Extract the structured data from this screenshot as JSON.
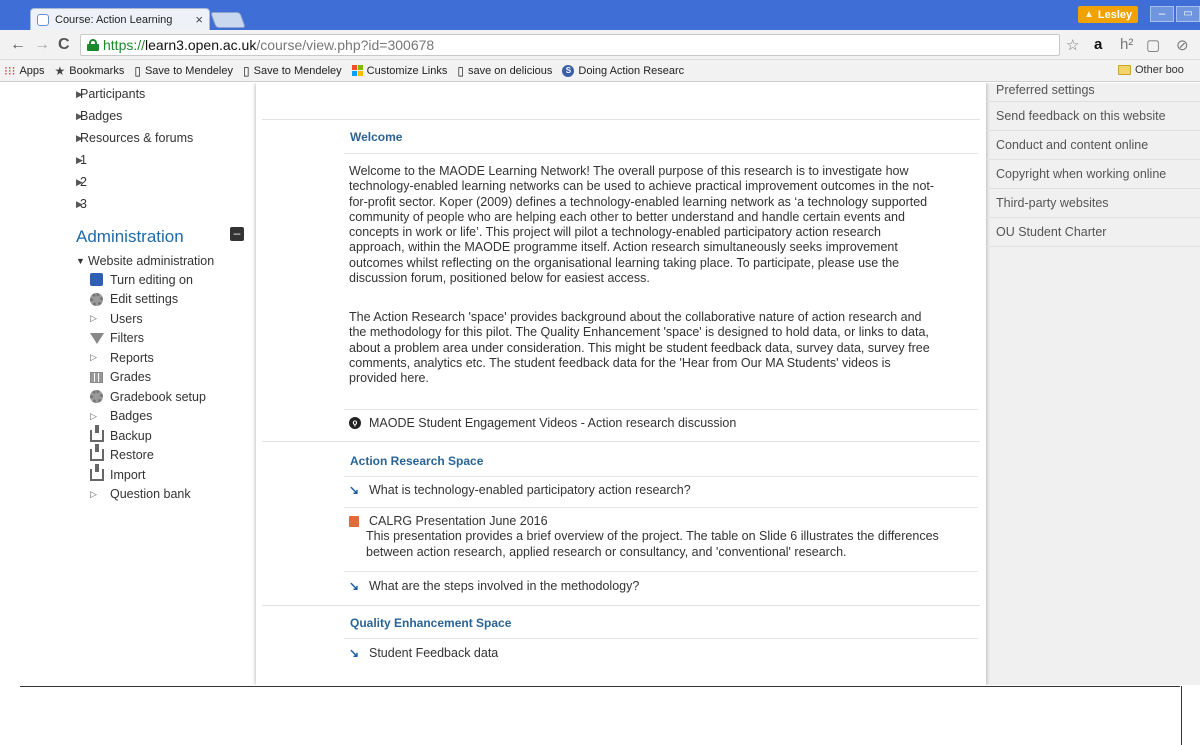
{
  "browser": {
    "tab_title": "Course: Action Learning",
    "tab_close": "×",
    "user_name": "Lesley",
    "user_warning": "▲",
    "win_min": "–",
    "win_max": "▭",
    "url_scheme": "https://",
    "url_host": "learn3.open.ac.uk",
    "url_path": "/course/view.php?id=300678",
    "back": "←",
    "forward": "→",
    "reload": "C",
    "ext_star": "☆",
    "ext_amazon": "a",
    "ext_h": "h²",
    "ext_doc": "▢",
    "ext_more": "⊘"
  },
  "bookmarks": [
    {
      "label": "Apps",
      "icon": "apps-grid-icon"
    },
    {
      "label": "Bookmarks",
      "icon": "star-icon"
    },
    {
      "label": "Save to Mendeley",
      "icon": "page-icon"
    },
    {
      "label": "Save to Mendeley",
      "icon": "page-icon"
    },
    {
      "label": "Customize Links",
      "icon": "windows-logo-icon"
    },
    {
      "label": "save on delicious",
      "icon": "page-icon"
    },
    {
      "label": "Doing Action Researc",
      "icon": "globe-icon"
    }
  ],
  "bookmark_icons": {
    "apps": "⁝⁝⁝",
    "star": "★",
    "page": "▯",
    "doing": "S"
  },
  "other_bookmarks": "Other boo",
  "left_nav": {
    "items": [
      {
        "label": "Participants"
      },
      {
        "label": "Badges"
      },
      {
        "label": "Resources & forums"
      },
      {
        "label": "1"
      },
      {
        "label": "2"
      },
      {
        "label": "3"
      }
    ],
    "administration_heading": "Administration",
    "collapse": "–",
    "website_admin": "Website administration",
    "admin_items": [
      {
        "label": "Turn editing on",
        "icon": "pencil-icon"
      },
      {
        "label": "Edit settings",
        "icon": "gear-icon"
      },
      {
        "label": "Users",
        "icon": "expand-triangle-icon"
      },
      {
        "label": "Filters",
        "icon": "funnel-icon"
      },
      {
        "label": "Reports",
        "icon": "expand-triangle-icon"
      },
      {
        "label": "Grades",
        "icon": "grid-icon"
      },
      {
        "label": "Gradebook setup",
        "icon": "gear-icon"
      },
      {
        "label": "Badges",
        "icon": "expand-triangle-icon"
      },
      {
        "label": "Backup",
        "icon": "upload-icon"
      },
      {
        "label": "Restore",
        "icon": "download-icon"
      },
      {
        "label": "Import",
        "icon": "download-icon"
      },
      {
        "label": "Question bank",
        "icon": "expand-triangle-icon"
      }
    ]
  },
  "content": {
    "welcome_title": "Welcome",
    "welcome_p1": "Welcome to the MAODE Learning Network! The overall purpose of this research is to investigate how technology-enabled learning networks can be used to achieve practical improvement outcomes in the not-for-profit sector. Koper (2009) defines a technology-enabled learning network as ‘a technology supported community of people who are helping each other to better understand and handle certain events and concepts in work or life’. This project will pilot a technology-enabled participatory action research approach, within the MAODE programme itself. Action research simultaneously seeks improvement outcomes whilst reflecting on the organisational learning taking place. To participate, please use the discussion forum, positioned below for easiest access.",
    "welcome_p2": "The Action Research 'space' provides background about the collaborative nature of action research and the methodology for this pilot. The Quality Enhancement 'space' is designed to hold data, or links to data, about a problem area under consideration. This might be student feedback data, survey data, survey free comments, analytics etc.  The student feedback data for the 'Hear from Our MA Students' videos is provided here.",
    "forum_link": "MAODE Student Engagement Videos - Action research discussion",
    "action_title": "Action Research Space",
    "ar_link1": "What is technology-enabled participatory action research?",
    "ar_ppt": "CALRG Presentation June 2016",
    "ar_ppt_desc": "This presentation provides a brief overview of the project. The table on Slide 6 illustrates the differences between action research, applied research or consultancy, and 'conventional' research.",
    "ar_link2": "What are the steps involved in the methodology?",
    "qe_title": "Quality Enhancement Space",
    "qe_link": "Student Feedback data"
  },
  "right_col": [
    {
      "label": "Preferred settings"
    },
    {
      "label": "Send feedback on this website"
    },
    {
      "label": "Conduct and content online"
    },
    {
      "label": "Copyright when working online"
    },
    {
      "label": "Third-party websites"
    },
    {
      "label": "OU Student Charter"
    }
  ],
  "colors": {
    "chrome_blue": "#3f6ed6",
    "link_blue": "#2a6496",
    "admin_blue": "#1f6aa9",
    "secure_green": "#1b8a2d"
  }
}
